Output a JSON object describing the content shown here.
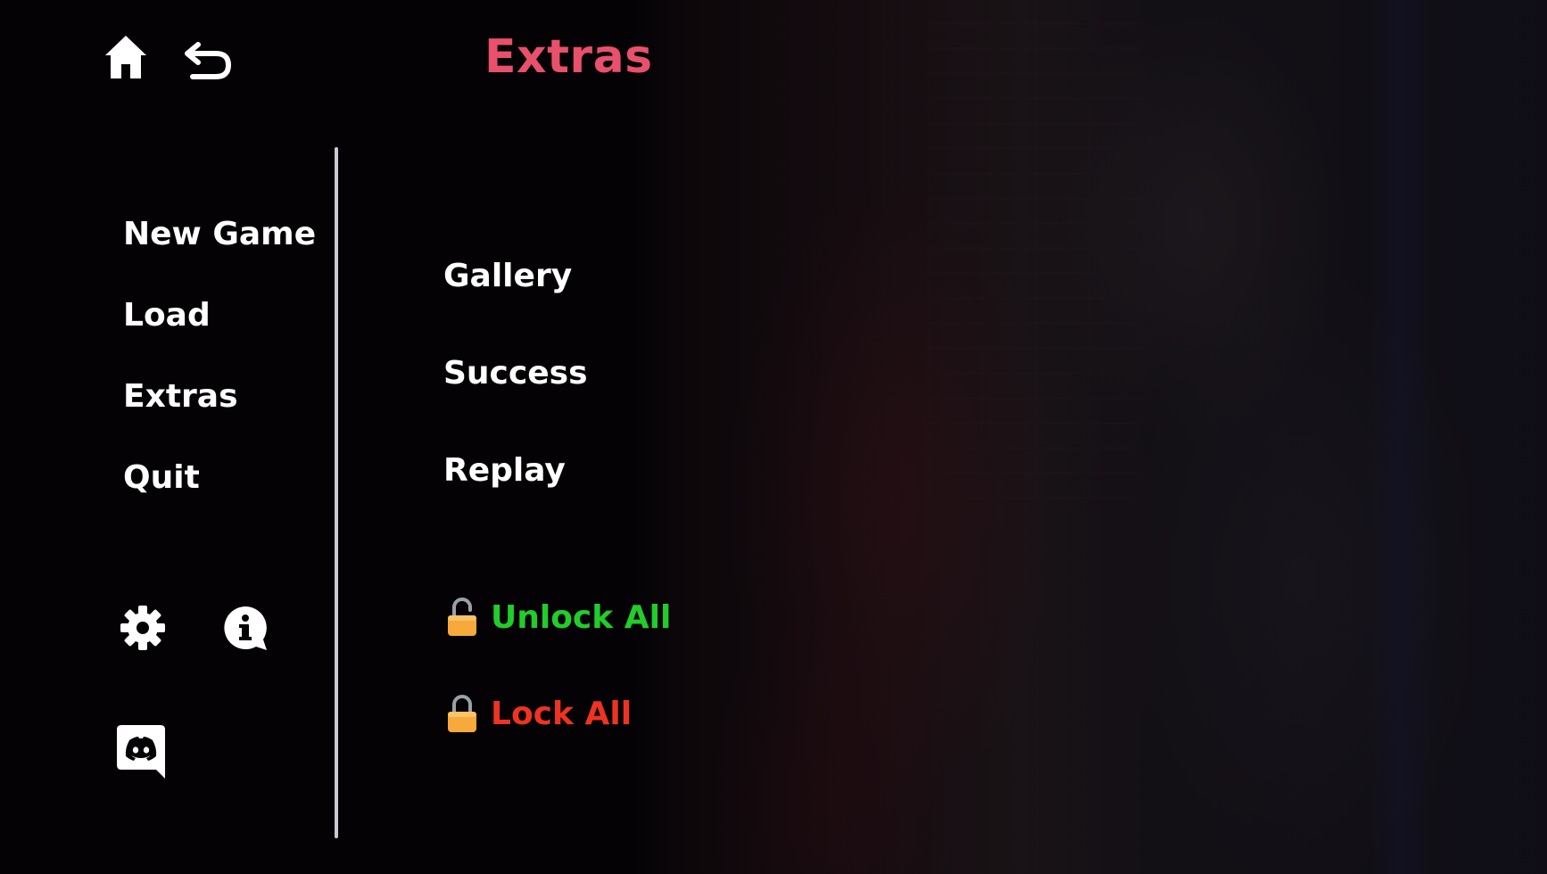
{
  "header": {
    "title": "Extras",
    "home_icon": "home-icon",
    "back_icon": "return-arrow-icon"
  },
  "main_menu": {
    "items": [
      {
        "label": "New Game"
      },
      {
        "label": "Load"
      },
      {
        "label": "Extras"
      },
      {
        "label": "Quit"
      }
    ]
  },
  "footer_icons": {
    "settings": "gear-icon",
    "info": "info-bubble-icon",
    "discord": "discord-icon"
  },
  "extras_menu": {
    "items": [
      {
        "label": "Gallery"
      },
      {
        "label": "Success"
      },
      {
        "label": "Replay"
      }
    ],
    "unlock_all": {
      "label": "Unlock All",
      "icon": "unlocked-padlock-icon",
      "color": "#22cc2a"
    },
    "lock_all": {
      "label": "Lock All",
      "icon": "locked-padlock-icon",
      "color": "#ee3322"
    }
  },
  "colors": {
    "title": "#e8506b",
    "menu_text": "#ffffff",
    "padlock": "#f7a93b",
    "divider": "#c9c9d4"
  }
}
